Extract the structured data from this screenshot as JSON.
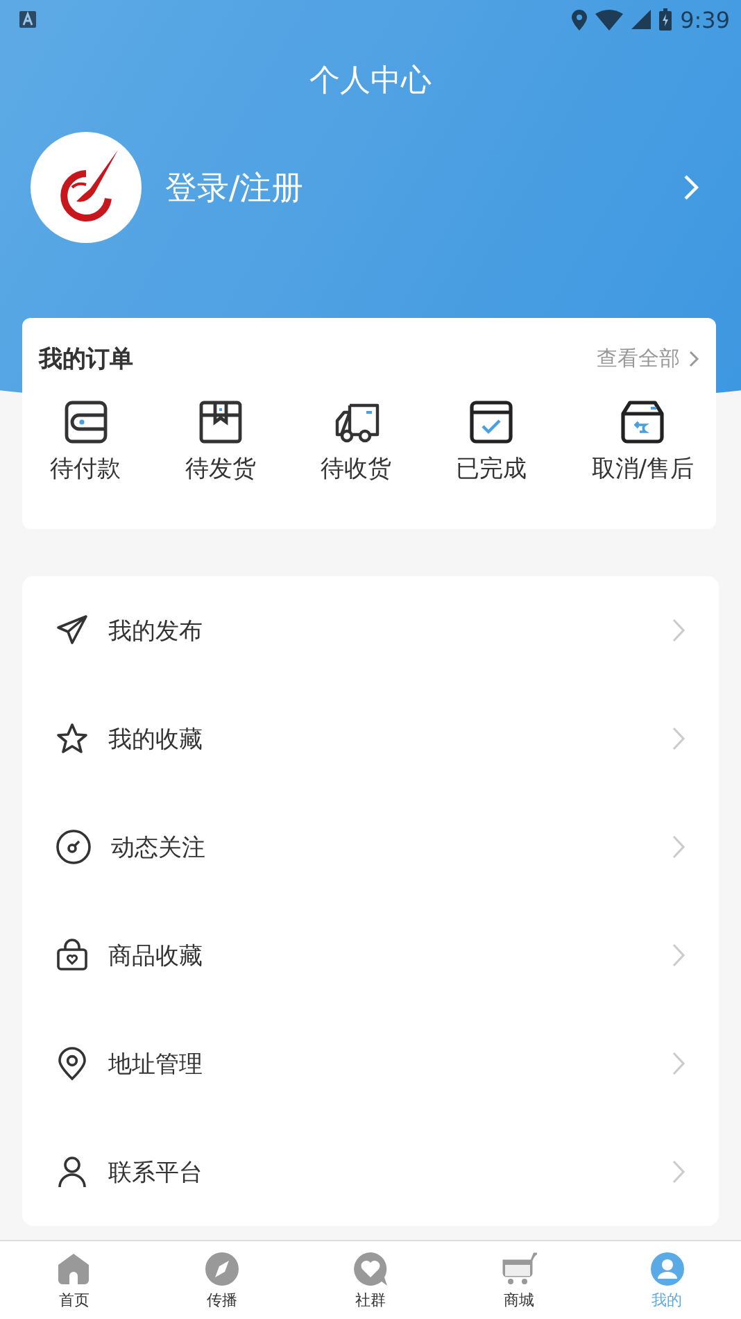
{
  "status_bar": {
    "time": "9:39"
  },
  "title": "个人中心",
  "profile": {
    "login_label": "登录/注册"
  },
  "orders": {
    "title": "我的订单",
    "view_all": "查看全部",
    "items": [
      "待付款",
      "待发货",
      "待收货",
      "已完成",
      "取消/售后"
    ]
  },
  "menu": [
    "我的发布",
    "我的收藏",
    "动态关注",
    "商品收藏",
    "地址管理",
    "联系平台"
  ],
  "tabs": [
    {
      "label": "首页",
      "selected": false
    },
    {
      "label": "传播",
      "selected": false
    },
    {
      "label": "社群",
      "selected": false
    },
    {
      "label": "商城",
      "selected": false
    },
    {
      "label": "我的",
      "selected": true
    }
  ]
}
